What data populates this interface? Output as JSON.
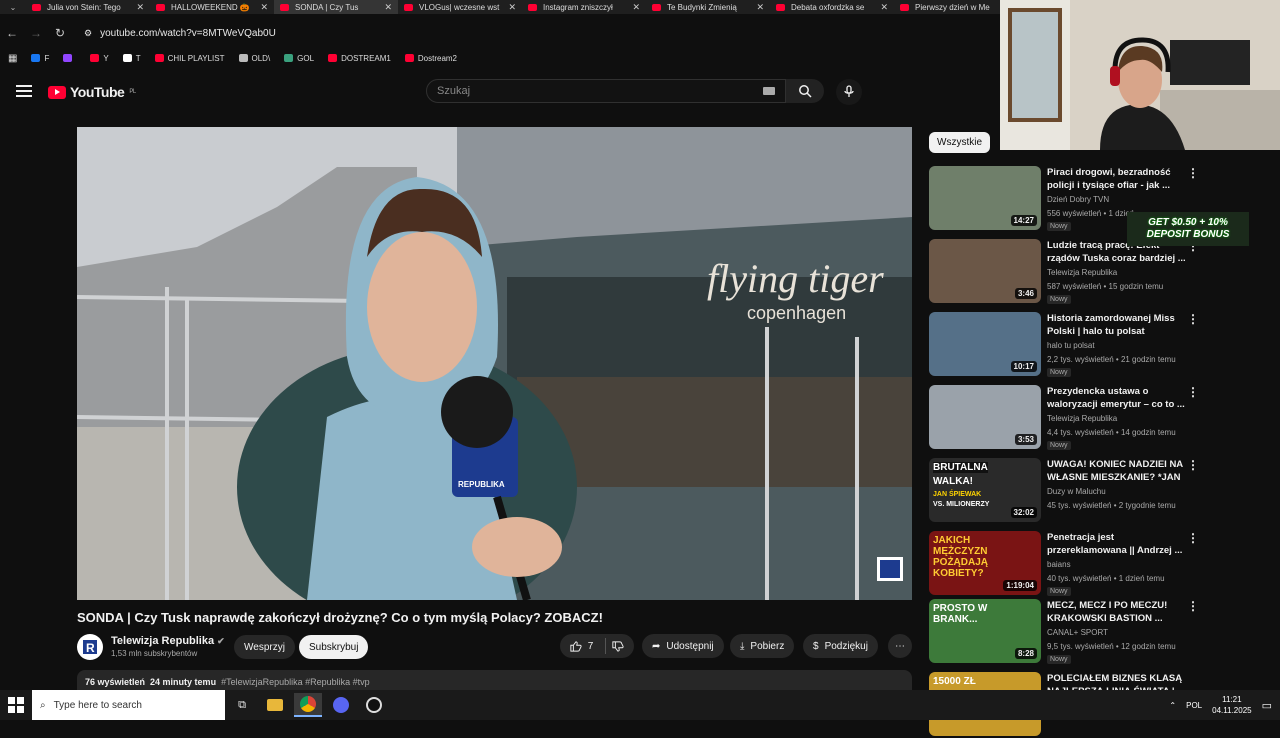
{
  "browser": {
    "tabs": [
      {
        "title": "Julia von Stein: Tego",
        "active": false
      },
      {
        "title": "HALLOWEEKEND 🎃",
        "active": false
      },
      {
        "title": "SONDA | Czy Tus",
        "active": true
      },
      {
        "title": "VLOGus| wczesne wst",
        "active": false
      },
      {
        "title": "Instagram zniszczył",
        "active": false
      },
      {
        "title": "Te Budynki Zmienią",
        "active": false
      },
      {
        "title": "Debata oxfordzka se",
        "active": false
      },
      {
        "title": "Pierwszy dzień w Me",
        "active": false
      }
    ],
    "url": "youtube.com/watch?v=8MTWeVQab0U",
    "bookmarks": [
      {
        "label": "F",
        "color": "#1877f2"
      },
      {
        "label": "",
        "color": "#9146ff"
      },
      {
        "label": "Y",
        "color": "#ff0033"
      },
      {
        "label": "T",
        "color": "#ffffff"
      },
      {
        "label": "CHIL PLAYLIST",
        "color": "#ff0033"
      },
      {
        "label": "OLD\\",
        "color": "#bbbbbb"
      },
      {
        "label": "GOL",
        "color": "#3aa17e"
      },
      {
        "label": "DOSTREAM1",
        "color": "#ff0033"
      },
      {
        "label": "Dostream2",
        "color": "#ff0033"
      }
    ]
  },
  "header": {
    "logo": "YouTube",
    "region": "PL",
    "search_placeholder": "Szukaj"
  },
  "video": {
    "title": "SONDA | Czy Tusk naprawdę zakończył drożyznę? Co o tym myślą Polacy? ZOBACZ!",
    "channel": "Telewizja Republika",
    "subscribers": "1,53 mln subskrybentów",
    "join_label": "Wesprzyj",
    "subscribe_label": "Subskrybuj",
    "likes": "7",
    "share_label": "Udostępnij",
    "download_label": "Pobierz",
    "thanks_label": "Podziękuj",
    "views": "76 wyświetleń",
    "time_ago": "24 minuty temu",
    "hashtags": "#TelewizjaRepublika #Republika #tvp",
    "mic_text": "REPUBLIKA",
    "bg_sign": "flying tiger",
    "bg_sign2": "copenhagen"
  },
  "sidebar": {
    "chip": "Wszystkie",
    "recommendations": [
      {
        "title": "Piraci drogowi, bezradność policji i tysiące ofiar - jak ...",
        "channel": "Dzień Dobry TVN",
        "meta": "556 wyświetleń • 1 dzień",
        "badge": "Nowy",
        "duration": "14:27",
        "thumb": "#6f7f6a"
      },
      {
        "title": "Ludzie tracą pracę! Efekt rządów Tuska coraz bardziej ...",
        "channel": "Telewizja Republika",
        "meta": "587 wyświetleń • 15 godzin temu",
        "badge": "Nowy",
        "duration": "3:46",
        "thumb": "#6b5747"
      },
      {
        "title": "Historia zamordowanej Miss Polski | halo tu polsat",
        "channel": "halo tu polsat",
        "meta": "2,2 tys. wyświetleń • 21 godzin temu",
        "badge": "Nowy",
        "duration": "10:17",
        "thumb": "#557088"
      },
      {
        "title": "Prezydencka ustawa o waloryzacji emerytur – co to ...",
        "channel": "Telewizja Republika",
        "meta": "4,4 tys. wyświetleń • 14 godzin temu",
        "badge": "Nowy",
        "duration": "3:53",
        "thumb": "#9aa2aa"
      },
      {
        "title": "UWAGA! KONIEC NADZIEI NA WŁASNE MIESZKANIE? *JAN ...",
        "channel": "Duzy w Maluchu",
        "meta": "45 tys. wyświetleń • 2 tygodnie temu",
        "badge": "",
        "duration": "32:02",
        "thumb": "#2a2a2a",
        "overlay1": "BRUTALNA",
        "overlay2": "WALKA!",
        "overlay3": "JAN ŚPIEWAK",
        "overlay4": "VS. MILIONERZY"
      },
      {
        "title": "Penetracja jest przereklamowana || Andrzej ...",
        "channel": "baians",
        "meta": "40 tys. wyświetleń • 1 dzień temu",
        "badge": "Nowy",
        "duration": "1:19:04",
        "thumb": "#7a1414",
        "overlay1": "JAKICH MĘŻCZYZN POŻĄDAJĄ KOBIETY?"
      },
      {
        "title": "MECZ, MECZ I PO MECZU! KRAKOWSKI BASTION ...",
        "channel": "CANAL+ SPORT",
        "meta": "9,5 tys. wyświetleń • 12 godzin temu",
        "badge": "Nowy",
        "duration": "8:28",
        "thumb": "#3d7a3a",
        "overlay1": "PROSTO W BRANK..."
      },
      {
        "title": "POLECIAŁEM BIZNES KLASĄ NAJLEPSZĄ LINIĄ ŚWIATA | ...",
        "channel": "",
        "meta": "",
        "badge": "",
        "duration": "",
        "thumb": "#c79a2a",
        "overlay1": "15000 ZŁ"
      }
    ]
  },
  "promo": {
    "line1": "GET $0.50 + 10%",
    "line2": "DEPOSIT BONUS"
  },
  "taskbar": {
    "search_placeholder": "Type here to search",
    "lang": "POL",
    "time": "11:21",
    "date": "04.11.2025"
  }
}
